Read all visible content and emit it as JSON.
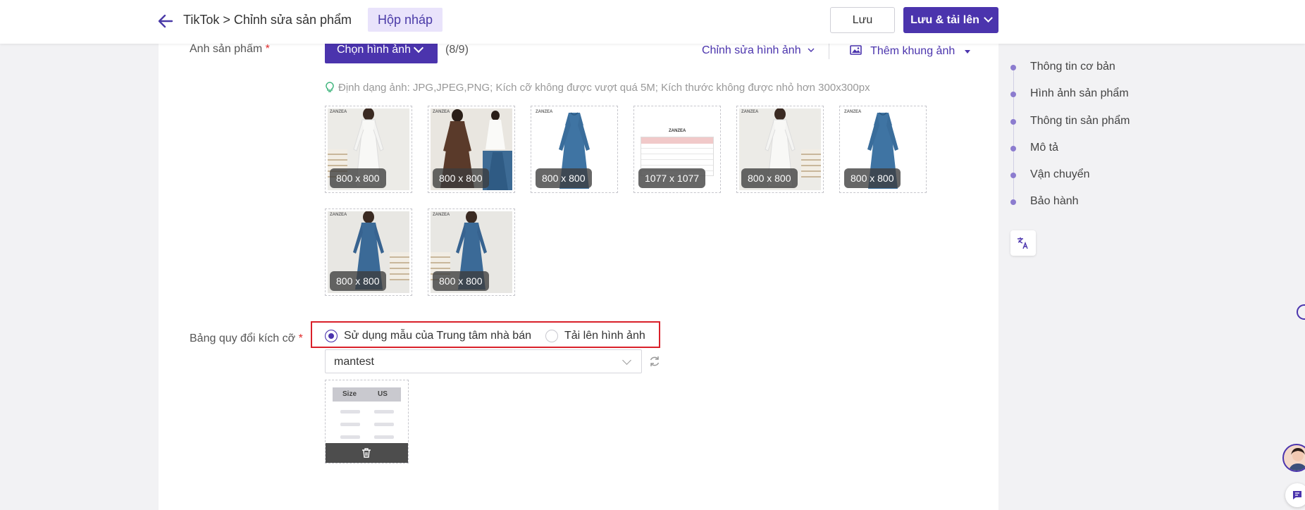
{
  "header": {
    "breadcrumb": "TikTok > Chỉnh sửa sản phẩm",
    "status_badge": "Hộp nháp",
    "save_label": "Lưu",
    "save_upload_label": "Lưu & tải lên"
  },
  "images_section": {
    "label": "Ảnh sản phẩm",
    "required_mark": "*",
    "choose_button": "Chọn hình ảnh",
    "count": "(8/9)",
    "edit_images_link": "Chỉnh sửa hình ảnh",
    "add_frame_link": "Thêm khung ảnh",
    "hint": "Định dạng ảnh: JPG,JPEG,PNG; Kích cỡ không được vượt quá 5M; Kích thước không được nhỏ hơn 300x300px",
    "thumbnails": [
      {
        "dims": "800 x 800",
        "kind": "white-dress"
      },
      {
        "dims": "800 x 800",
        "kind": "brown-dress-collage"
      },
      {
        "dims": "800 x 800",
        "kind": "blue-dress"
      },
      {
        "dims": "1077 x 1077",
        "kind": "size-chart"
      },
      {
        "dims": "800 x 800",
        "kind": "white-dress"
      },
      {
        "dims": "800 x 800",
        "kind": "blue-dress"
      },
      {
        "dims": "800 x 800",
        "kind": "blue-dress-model"
      },
      {
        "dims": "800 x 800",
        "kind": "blue-dress-model"
      }
    ],
    "thumbnail_brand": "ZANZEA"
  },
  "size_section": {
    "label": "Bảng quy đổi kích cỡ",
    "required_mark": "*",
    "option_template": "Sử dụng mẫu của Trung tâm nhà bán",
    "option_upload": "Tải lên hình ảnh",
    "selected_option": "template",
    "template_select_value": "mantest",
    "template_preview": {
      "col1": "Size",
      "col2": "US"
    }
  },
  "side_nav": {
    "items": [
      "Thông tin cơ bản",
      "Hình ảnh sản phẩm",
      "Thông tin sản phẩm",
      "Mô tả",
      "Vận chuyển",
      "Bảo hành"
    ]
  },
  "colors": {
    "primary": "#4b34ad",
    "draft_bg": "#e9e3fb",
    "highlight_border": "#d9202a"
  }
}
